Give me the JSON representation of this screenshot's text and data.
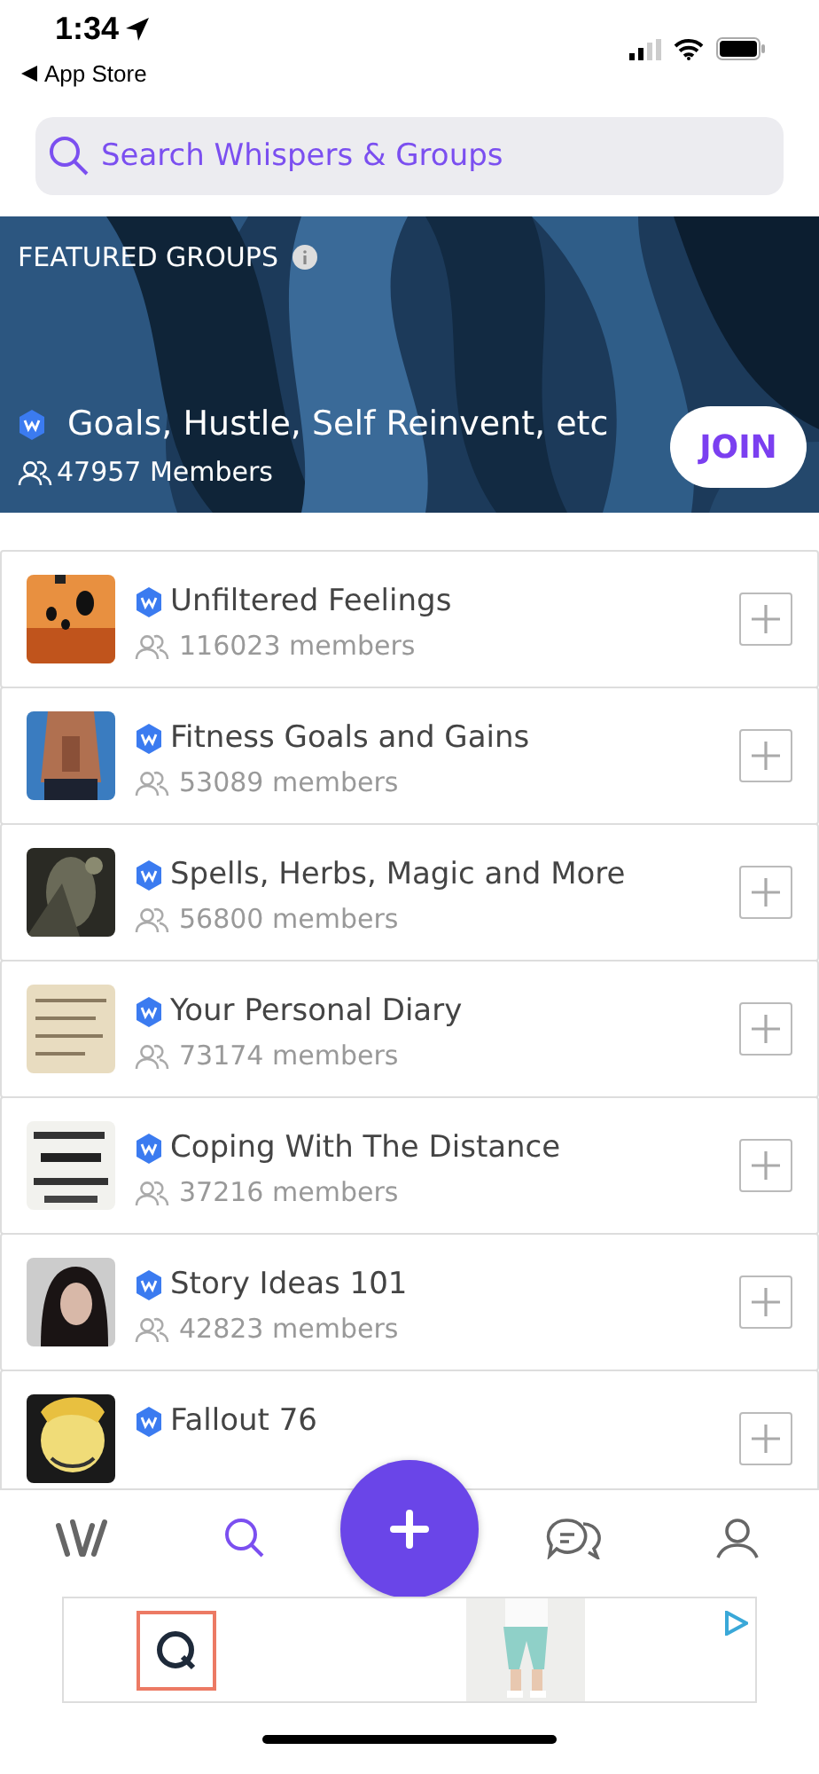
{
  "status_bar": {
    "time": "1:34",
    "back_label": "App Store"
  },
  "search": {
    "placeholder": "Search Whispers & Groups"
  },
  "featured": {
    "heading": "FEATURED GROUPS",
    "group_name": "Goals, Hustle, Self Reinvent, etc",
    "members": "47957 Members",
    "join_button": "JOIN"
  },
  "groups": [
    {
      "name": "Unfiltered Feelings",
      "members": "116023 members"
    },
    {
      "name": "Fitness Goals and Gains",
      "members": "53089 members"
    },
    {
      "name": "Spells, Herbs, Magic and More",
      "members": "56800 members"
    },
    {
      "name": "Your Personal Diary",
      "members": "73174 members"
    },
    {
      "name": "Coping With The Distance",
      "members": "37216 members"
    },
    {
      "name": "Story Ideas 101",
      "members": "42823 members"
    },
    {
      "name": "Fallout 76"
    }
  ],
  "tab_bar": {
    "tabs": [
      {
        "kind": "home",
        "selected": false
      },
      {
        "kind": "search",
        "selected": true
      },
      {
        "kind": "messages",
        "selected": false
      },
      {
        "kind": "profile",
        "selected": false
      }
    ]
  }
}
